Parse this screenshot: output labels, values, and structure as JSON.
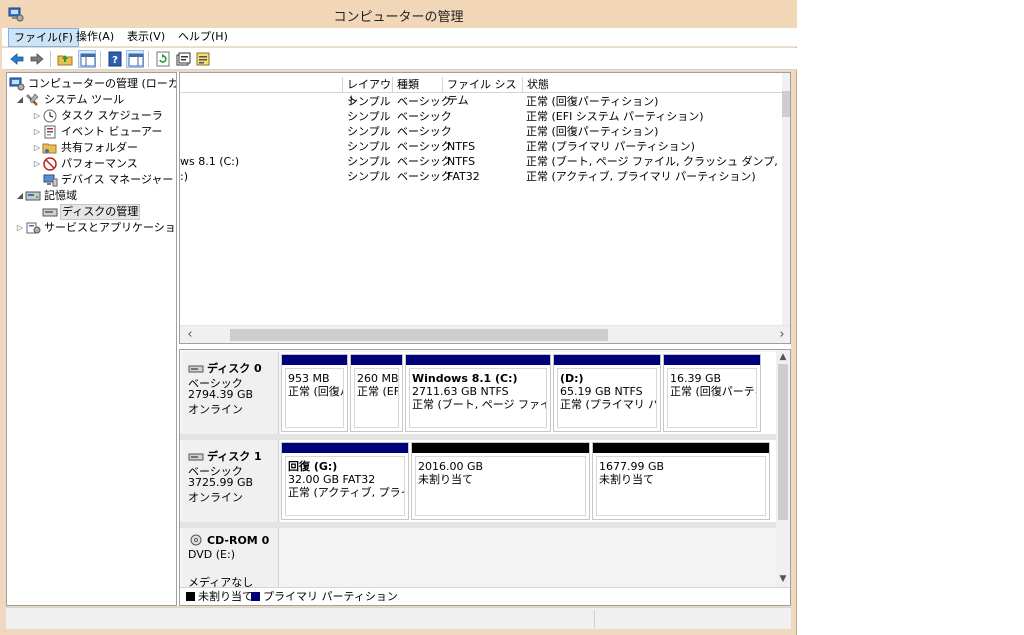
{
  "window": {
    "title": "コンピューターの管理"
  },
  "colors": {
    "unallocated": "#000000",
    "primary": "#00007b",
    "titlebar": "#f2d6b8"
  },
  "menubar": {
    "items": [
      {
        "label": "ファイル(F)"
      },
      {
        "label": "操作(A)"
      },
      {
        "label": "表示(V)"
      },
      {
        "label": "ヘルプ(H)"
      }
    ]
  },
  "toolbar": {
    "buttons": [
      "back-icon",
      "forward-icon",
      "up-folder-icon",
      "show-console-tree-icon",
      "help-icon",
      "show-action-pane-icon",
      "refresh-icon",
      "properties-icon",
      "export-icon"
    ]
  },
  "tree": {
    "items": [
      {
        "label": "コンピューターの管理 (ローカル)",
        "icon": "computer-management-icon",
        "level": 0,
        "expander": ""
      },
      {
        "label": "システム ツール",
        "icon": "system-tools-icon",
        "level": 1,
        "expander": "◢"
      },
      {
        "label": "タスク スケジューラ",
        "icon": "task-scheduler-icon",
        "level": 2,
        "expander": "▷"
      },
      {
        "label": "イベント ビューアー",
        "icon": "event-viewer-icon",
        "level": 2,
        "expander": "▷"
      },
      {
        "label": "共有フォルダー",
        "icon": "shared-folders-icon",
        "level": 2,
        "expander": "▷"
      },
      {
        "label": "パフォーマンス",
        "icon": "performance-icon",
        "level": 2,
        "expander": "▷"
      },
      {
        "label": "デバイス マネージャー",
        "icon": "device-manager-icon",
        "level": 2,
        "expander": ""
      },
      {
        "label": "記憶域",
        "icon": "storage-icon",
        "level": 1,
        "expander": "◢"
      },
      {
        "label": "ディスクの管理",
        "icon": "disk-management-icon",
        "level": 2,
        "expander": "",
        "selected": true
      },
      {
        "label": "サービスとアプリケーション",
        "icon": "services-apps-icon",
        "level": 1,
        "expander": "▷"
      }
    ]
  },
  "volumes": {
    "columns": [
      "レイアウト",
      "種類",
      "ファイル システム",
      "状態"
    ],
    "rows": [
      {
        "volume": "",
        "layout": "シンプル",
        "type": "ベーシック",
        "fs": "",
        "status": "正常 (回復パーティション)"
      },
      {
        "volume": "",
        "layout": "シンプル",
        "type": "ベーシック",
        "fs": "",
        "status": "正常 (EFI システム パーティション)"
      },
      {
        "volume": "",
        "layout": "シンプル",
        "type": "ベーシック",
        "fs": "",
        "status": "正常 (回復パーティション)"
      },
      {
        "volume": "",
        "layout": "シンプル",
        "type": "ベーシック",
        "fs": "NTFS",
        "status": "正常 (プライマリ パーティション)"
      },
      {
        "volume": "ws 8.1 (C:)",
        "layout": "シンプル",
        "type": "ベーシック",
        "fs": "NTFS",
        "status": "正常 (ブート, ページ ファイル, クラッシュ ダンプ, プライマリ パーテ"
      },
      {
        "volume": ":)",
        "layout": "シンプル",
        "type": "ベーシック",
        "fs": "FAT32",
        "status": "正常 (アクティブ, プライマリ パーティション)"
      }
    ]
  },
  "disks": [
    {
      "name": "ディスク 0",
      "icon": "hard-disk-icon",
      "lines": [
        "ベーシック",
        "2794.39 GB",
        "オンライン"
      ],
      "partitions": [
        {
          "kind": "primary",
          "title": "",
          "size": "953 MB",
          "status": "正常 (回復パ"
        },
        {
          "kind": "primary",
          "title": "",
          "size": "260 MB",
          "status": "正常 (EF"
        },
        {
          "kind": "primary",
          "title": "Windows 8.1  (C:)",
          "size": "2711.63 GB NTFS",
          "status": "正常 (ブート, ページ ファイル, ク"
        },
        {
          "kind": "primary",
          "title": " (D:)",
          "size": "65.19 GB NTFS",
          "status": "正常 (プライマリ パーテ"
        },
        {
          "kind": "primary",
          "title": "",
          "size": "16.39 GB",
          "status": "正常 (回復パーティ"
        }
      ]
    },
    {
      "name": "ディスク 1",
      "icon": "hard-disk-icon",
      "lines": [
        "ベーシック",
        "3725.99 GB",
        "オンライン"
      ],
      "partitions": [
        {
          "kind": "primary",
          "title": "回復  (G:)",
          "size": "32.00 GB FAT32",
          "status": "正常 (アクティブ, プライマリ"
        },
        {
          "kind": "unallocated",
          "title": "",
          "size": "2016.00 GB",
          "status": "未割り当て"
        },
        {
          "kind": "unallocated",
          "title": "",
          "size": "1677.99 GB",
          "status": "未割り当て"
        }
      ]
    },
    {
      "name": "CD-ROM 0",
      "icon": "cd-rom-icon",
      "lines": [
        "DVD (E:)",
        "",
        "",
        "メディアなし"
      ],
      "partitions": []
    }
  ],
  "legend": [
    {
      "kind": "unallocated",
      "label": "未割り当て"
    },
    {
      "kind": "primary",
      "label": "プライマリ パーティション"
    }
  ]
}
